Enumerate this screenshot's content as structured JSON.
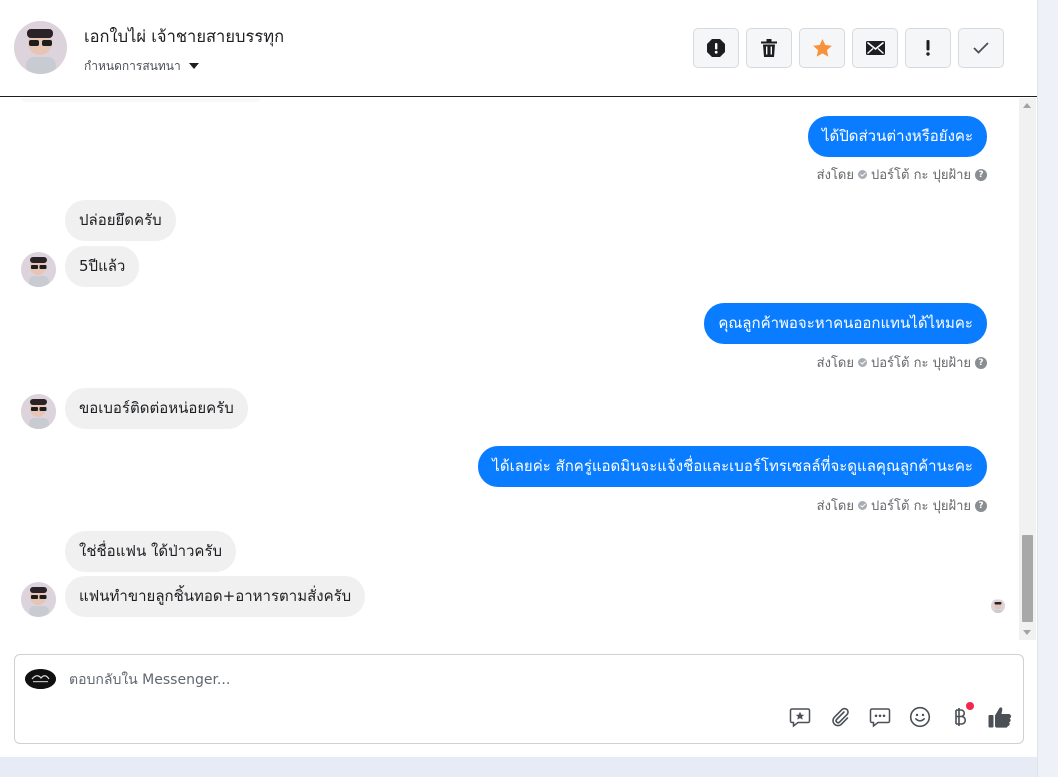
{
  "header": {
    "contact_name": "เอกใบไผ่ เจ้าชายสายบรรทุก",
    "assign_label": "กำหนดการสนทนา",
    "toolbar": [
      {
        "name": "mark-spam",
        "icon": "alert-circle-icon"
      },
      {
        "name": "delete",
        "icon": "trash-icon"
      },
      {
        "name": "star",
        "icon": "star-icon",
        "color": "#f7923a"
      },
      {
        "name": "mark-unread",
        "icon": "envelope-icon"
      },
      {
        "name": "follow-up",
        "icon": "exclamation-icon"
      },
      {
        "name": "mark-done",
        "icon": "checkmark-icon"
      }
    ]
  },
  "messages": [
    {
      "direction": "out",
      "text": "ได้ปิดส่วนต่างหรือยังคะ",
      "sent_by": "ส่งโดย",
      "agent": "ปอร์โต้ กะ ปุยฝ้าย"
    },
    {
      "direction": "in",
      "text": "ปล่อยยึดครับ"
    },
    {
      "direction": "in",
      "text": "5ปีแล้ว"
    },
    {
      "direction": "out",
      "text": "คุณลูกค้าพอจะหาคนออกแทนได้ไหมคะ",
      "sent_by": "ส่งโดย",
      "agent": "ปอร์โต้ กะ ปุยฝ้าย"
    },
    {
      "direction": "in",
      "text": "ขอเบอร์ติดต่อหน่อยครับ"
    },
    {
      "direction": "out",
      "text": "ได้เลยค่ะ สักครู่แอดมินจะแจ้งชื่อและเบอร์โทรเซลล์ที่จะดูแลคุณลูกค้านะคะ",
      "sent_by": "ส่งโดย",
      "agent": "ปอร์โต้ กะ ปุยฝ้าย"
    },
    {
      "direction": "in",
      "text": "ใช่ชื่อแฟน ใด้ป่าวครับ"
    },
    {
      "direction": "in",
      "text": "แฟนทำขายลูกชิ้นทอด+อาหารตามสั่งครับ"
    }
  ],
  "composer": {
    "placeholder": "ตอบกลับใน Messenger...",
    "value": "",
    "icons": [
      "saved-reply-icon",
      "attachment-icon",
      "quick-reply-icon",
      "emoji-icon",
      "baht-payment-icon",
      "like-icon"
    ]
  },
  "colors": {
    "outgoing_bubble": "#0a7cff",
    "incoming_bubble": "#f0f0f0",
    "notification_dot": "#f02849"
  }
}
